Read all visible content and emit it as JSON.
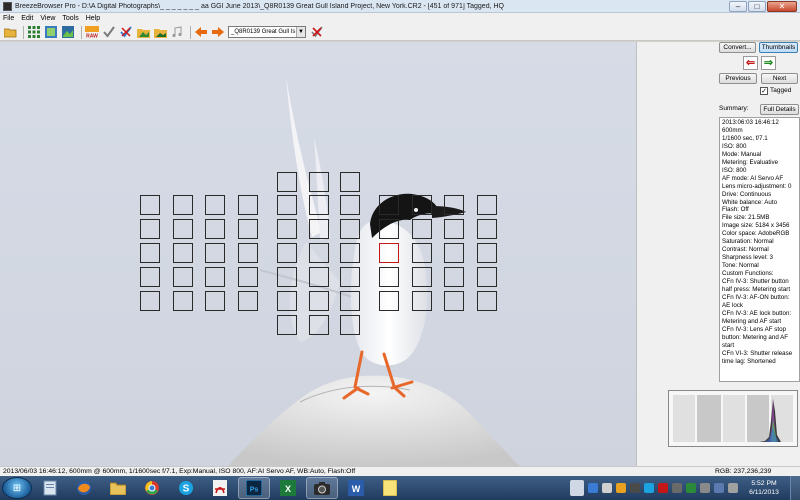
{
  "window": {
    "title": "BreezeBrowser Pro - D:\\A Digital Photographs\\_ _ _ _ _ _ _ aa GGI June 2013\\_Q8R0139  Great Gull Island Project, New York.CR2 - [451 of 971] Tagged, HQ",
    "minimize": "–",
    "maximize": "□",
    "close": "✕"
  },
  "menu": [
    "File",
    "Edit",
    "View",
    "Tools",
    "Help"
  ],
  "toolbar": {
    "file_select": "_Q8R0139  Great Gull Is",
    "icons": [
      "open-folder-icon",
      "thumbnails-grid-icon",
      "filmstrip-icon",
      "image-view-icon",
      "raw-icon",
      "tag-check-icon",
      "untag-icon",
      "folder-image-icon",
      "folder-image-alt-icon",
      "audio-note-icon",
      "previous-arrow-icon",
      "next-arrow-icon",
      "clear-tag-icon"
    ]
  },
  "panel": {
    "convert_label": "Convert...",
    "thumbnails_label": "Thumbnails",
    "previous_label": "Previous",
    "next_label": "Next",
    "tagged_label": "Tagged",
    "summary_label": "Summary:",
    "full_details_label": "Full Details",
    "info_lines": [
      "2013:06:03 16:46:12",
      "600mm",
      "1/1600 sec, f/7.1",
      "ISO: 800",
      "Mode: Manual",
      "Metering: Evaluative",
      "ISO: 800",
      "AF mode: AI Servo AF",
      "Lens micro-adjustment: 0",
      "Drive: Continuous",
      "White balance: Auto",
      "Flash: Off",
      "File size: 21.5MB",
      "Image size: 5184 x 3456",
      "Color space: AdobeRGB",
      "Saturation: Normal",
      "Contrast: Normal",
      "Sharpness level: 3",
      "Tone: Normal",
      "Custom Functions:",
      "CFn IV-3: Shutter button half press: Metering start",
      "CFn IV-3: AF-ON button: AE lock",
      "CFn IV-3: AE lock button: Metering and AF start",
      "CFn IV-3: Lens AF stop button: Metering and AF start",
      "CFn VI-3: Shutter release time lag: Shortened"
    ]
  },
  "status": {
    "left": "2013/06/03 16:46:12, 600mm @ 600mm, 1/1600sec f/7.1, Exp:Manual, ISO 800, AF:AI Servo AF, WB:Auto, Flash:Off",
    "right": "RGB: 237,236,239"
  },
  "taskbar": {
    "time": "5:52 PM",
    "date": "6/11/2013"
  },
  "colors": {
    "af_point": "#2a2a2a",
    "af_point_selected": "#c41818",
    "sky": "#d4d9e4"
  },
  "af_grid": [
    {
      "col": 4,
      "row": 0
    },
    {
      "col": 5,
      "row": 0
    },
    {
      "col": 6,
      "row": 0
    },
    {
      "col": 0,
      "row": 1
    },
    {
      "col": 1,
      "row": 1
    },
    {
      "col": 2,
      "row": 1
    },
    {
      "col": 3,
      "row": 1
    },
    {
      "col": 4,
      "row": 1
    },
    {
      "col": 5,
      "row": 1
    },
    {
      "col": 6,
      "row": 1
    },
    {
      "col": 7,
      "row": 1
    },
    {
      "col": 8,
      "row": 1
    },
    {
      "col": 9,
      "row": 1
    },
    {
      "col": 10,
      "row": 1
    },
    {
      "col": 0,
      "row": 2
    },
    {
      "col": 1,
      "row": 2
    },
    {
      "col": 2,
      "row": 2
    },
    {
      "col": 3,
      "row": 2
    },
    {
      "col": 4,
      "row": 2
    },
    {
      "col": 5,
      "row": 2
    },
    {
      "col": 6,
      "row": 2
    },
    {
      "col": 7,
      "row": 2
    },
    {
      "col": 8,
      "row": 2
    },
    {
      "col": 9,
      "row": 2
    },
    {
      "col": 10,
      "row": 2
    },
    {
      "col": 0,
      "row": 3
    },
    {
      "col": 1,
      "row": 3
    },
    {
      "col": 2,
      "row": 3
    },
    {
      "col": 3,
      "row": 3
    },
    {
      "col": 4,
      "row": 3
    },
    {
      "col": 5,
      "row": 3
    },
    {
      "col": 6,
      "row": 3
    },
    {
      "col": 7,
      "row": 3,
      "selected": true
    },
    {
      "col": 8,
      "row": 3
    },
    {
      "col": 9,
      "row": 3
    },
    {
      "col": 10,
      "row": 3
    },
    {
      "col": 0,
      "row": 4
    },
    {
      "col": 1,
      "row": 4
    },
    {
      "col": 2,
      "row": 4
    },
    {
      "col": 3,
      "row": 4
    },
    {
      "col": 4,
      "row": 4
    },
    {
      "col": 5,
      "row": 4
    },
    {
      "col": 6,
      "row": 4
    },
    {
      "col": 7,
      "row": 4
    },
    {
      "col": 8,
      "row": 4
    },
    {
      "col": 9,
      "row": 4
    },
    {
      "col": 10,
      "row": 4
    },
    {
      "col": 0,
      "row": 5
    },
    {
      "col": 1,
      "row": 5
    },
    {
      "col": 2,
      "row": 5
    },
    {
      "col": 3,
      "row": 5
    },
    {
      "col": 4,
      "row": 5
    },
    {
      "col": 5,
      "row": 5
    },
    {
      "col": 6,
      "row": 5
    },
    {
      "col": 7,
      "row": 5
    },
    {
      "col": 8,
      "row": 5
    },
    {
      "col": 9,
      "row": 5
    },
    {
      "col": 10,
      "row": 5
    },
    {
      "col": 4,
      "row": 6
    },
    {
      "col": 5,
      "row": 6
    },
    {
      "col": 6,
      "row": 6
    }
  ]
}
